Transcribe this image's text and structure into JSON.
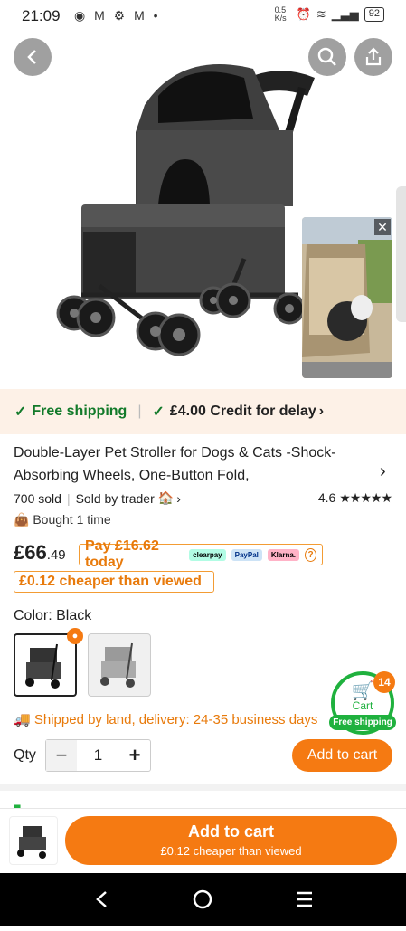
{
  "status_bar": {
    "time": "21:09",
    "notification_icons": "◉ M ⚙ M •",
    "net_speed": "0.5 K/s",
    "battery": "92"
  },
  "promo": {
    "free_shipping": "Free shipping",
    "credit": "£4.00 Credit for delay"
  },
  "product": {
    "title": "Double-Layer Pet Stroller for Dogs & Cats -Shock-Absorbing Wheels, One-Button Fold,",
    "sold": "700 sold",
    "sold_by": "Sold by trader",
    "rating": "4.6",
    "stars": "★★★★★",
    "bought": "Bought 1 time",
    "price_main": "£66",
    "price_decimal": ".49",
    "pay_today": "Pay £16.62 today",
    "pay_methods": [
      "clearpay",
      "PayPal",
      "Klarna."
    ],
    "cheaper": "£0.12 cheaper than viewed",
    "color_label": "Color: Black",
    "shipping": "Shipped by land, delivery: 24-35 business days",
    "qty_label": "Qty",
    "qty_value": "1"
  },
  "cart_fab": {
    "label": "Cart",
    "count": "14",
    "free_shipping": "Free shipping"
  },
  "buttons": {
    "add_to_cart": "Add to cart",
    "add_to_cart_big": "Add to cart",
    "add_to_cart_sub": "£0.12 cheaper than viewed"
  },
  "colors": {
    "accent": "#f57a12",
    "green": "#1fb13e"
  }
}
